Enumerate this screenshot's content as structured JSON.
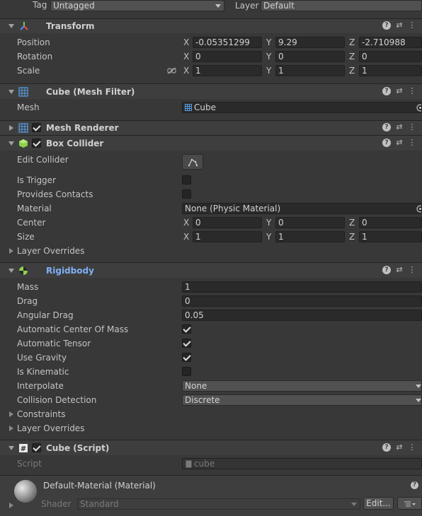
{
  "top": {
    "tag_label": "Tag",
    "tag_value": "Untagged",
    "layer_label": "Layer",
    "layer_value": "Default"
  },
  "transform": {
    "title": "Transform",
    "position_label": "Position",
    "rotation_label": "Rotation",
    "scale_label": "Scale",
    "axes": [
      "X",
      "Y",
      "Z"
    ],
    "position": [
      "-0.05351299",
      "9.29",
      "-2.710988"
    ],
    "rotation": [
      "0",
      "0",
      "0"
    ],
    "scale": [
      "1",
      "1",
      "1"
    ]
  },
  "mesh_filter": {
    "title": "Cube (Mesh Filter)",
    "mesh_label": "Mesh",
    "mesh_value": "Cube"
  },
  "mesh_renderer": {
    "title": "Mesh Renderer"
  },
  "box_collider": {
    "title": "Box Collider",
    "edit_collider_label": "Edit Collider",
    "is_trigger_label": "Is Trigger",
    "provides_contacts_label": "Provides Contacts",
    "material_label": "Material",
    "material_value": "None (Physic Material)",
    "center_label": "Center",
    "size_label": "Size",
    "layer_overrides_label": "Layer Overrides",
    "center": [
      "0",
      "0",
      "0"
    ],
    "size": [
      "1",
      "1",
      "1"
    ]
  },
  "rigidbody": {
    "title": "Rigidbody",
    "mass_label": "Mass",
    "mass": "1",
    "drag_label": "Drag",
    "drag": "0",
    "angular_drag_label": "Angular Drag",
    "angular_drag": "0.05",
    "auto_center_label": "Automatic Center Of Mass",
    "auto_tensor_label": "Automatic Tensor",
    "use_gravity_label": "Use Gravity",
    "is_kinematic_label": "Is Kinematic",
    "interpolate_label": "Interpolate",
    "interpolate": "None",
    "collision_label": "Collision Detection",
    "collision": "Discrete",
    "constraints_label": "Constraints",
    "layer_overrides_label": "Layer Overrides",
    "title_color": "#7fb0f5"
  },
  "script": {
    "title": "Cube (Script)",
    "script_label": "Script",
    "script_value": "cube"
  },
  "material": {
    "title": "Default-Material (Material)",
    "shader_label": "Shader",
    "shader_value": "Standard",
    "edit_label": "Edit..."
  }
}
